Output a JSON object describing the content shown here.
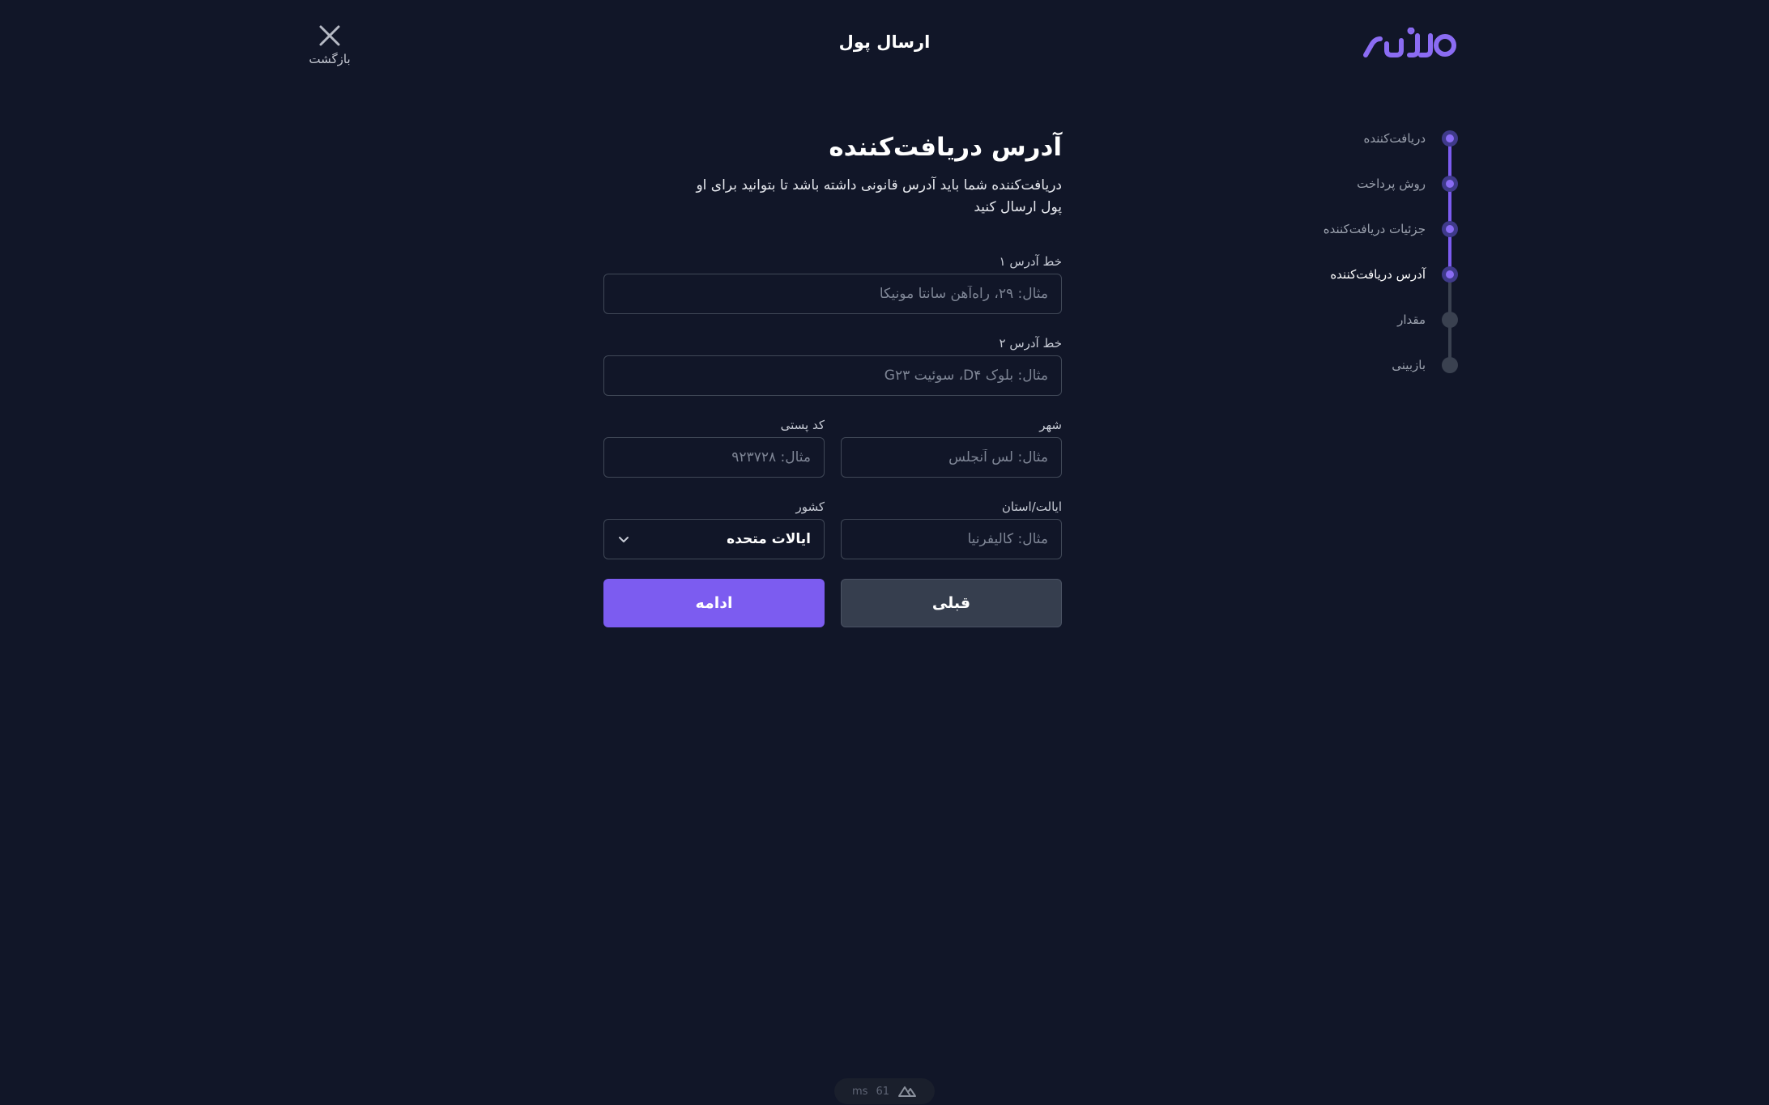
{
  "header": {
    "logo_text": "ناتیرو",
    "title": "ارسال پول",
    "back_label": "بازگشت"
  },
  "stepper": {
    "steps": [
      {
        "label": "دریافت‌کننده",
        "state": "done"
      },
      {
        "label": "روش پرداخت",
        "state": "done"
      },
      {
        "label": "جزئیات دریافت‌کننده",
        "state": "done"
      },
      {
        "label": "آدرس دریافت‌کننده",
        "state": "current"
      },
      {
        "label": "مقدار",
        "state": "todo"
      },
      {
        "label": "بازبینی",
        "state": "todo"
      }
    ]
  },
  "form": {
    "title": "آدرس دریافت‌کننده",
    "description": "دریافت‌کننده شما باید آدرس قانونی داشته باشد تا بتوانید برای او پول ارسال کنید",
    "address1": {
      "label": "خط آدرس ۱",
      "placeholder": "مثال: ۲۹، راه‌آهن سانتا مونیکا",
      "value": ""
    },
    "address2": {
      "label": "خط آدرس ۲",
      "placeholder": "مثال: بلوک D۴، سوئیت G۲۳",
      "value": ""
    },
    "city": {
      "label": "شهر",
      "placeholder": "مثال: لس آنجلس",
      "value": ""
    },
    "postal_code": {
      "label": "کد پستی",
      "placeholder": "مثال: ۹۲۳۷۲۸",
      "value": ""
    },
    "state": {
      "label": "ایالت/استان",
      "placeholder": "مثال: کالیفرنیا",
      "value": ""
    },
    "country": {
      "label": "کشور",
      "selected": "ایالات متحده"
    },
    "prev_label": "قبلی",
    "next_label": "ادامه"
  },
  "dev_badge": {
    "ms_value": "61",
    "ms_unit": "ms"
  },
  "colors": {
    "background": "#111628",
    "accent": "#7c5cf0",
    "secondary_button": "#363e4e",
    "input_border": "#404857"
  }
}
